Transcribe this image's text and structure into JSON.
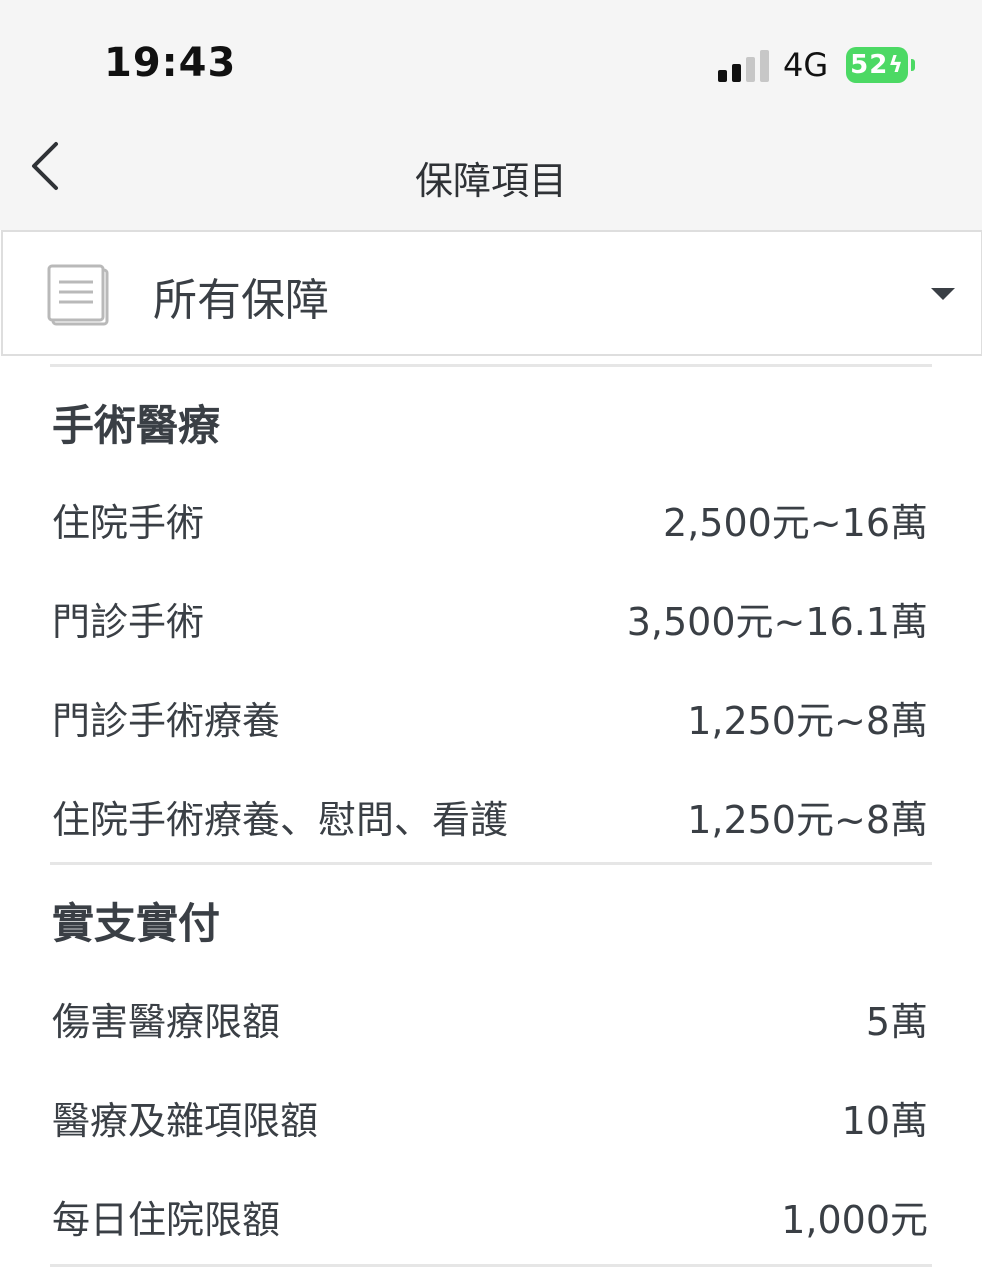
{
  "status_bar": {
    "time": "19:43",
    "network": "4G",
    "battery": "52",
    "battery_color": "#4cd964",
    "signal_bars_active": 2,
    "signal_bars_total": 4
  },
  "nav": {
    "title": "保障項目",
    "back_icon": "chevron-left-icon"
  },
  "filter": {
    "label": "所有保障",
    "icon": "document-icon",
    "dropdown_icon": "caret-down-icon"
  },
  "sections": [
    {
      "title": "手術醫療",
      "rows": [
        {
          "label": "住院手術",
          "value": "2,500元~16萬"
        },
        {
          "label": "門診手術",
          "value": "3,500元~16.1萬"
        },
        {
          "label": "門診手術療養",
          "value": "1,250元~8萬"
        },
        {
          "label": "住院手術療養、慰問、看護",
          "value": "1,250元~8萬"
        }
      ]
    },
    {
      "title": "實支實付",
      "rows": [
        {
          "label": "傷害醫療限額",
          "value": "5萬"
        },
        {
          "label": "醫療及雜項限額",
          "value": "10萬"
        },
        {
          "label": "每日住院限額",
          "value": "1,000元"
        }
      ]
    }
  ],
  "colors": {
    "text": "#3a3f45",
    "header_bg": "#f5f5f5",
    "divider": "#e6e6e6"
  }
}
